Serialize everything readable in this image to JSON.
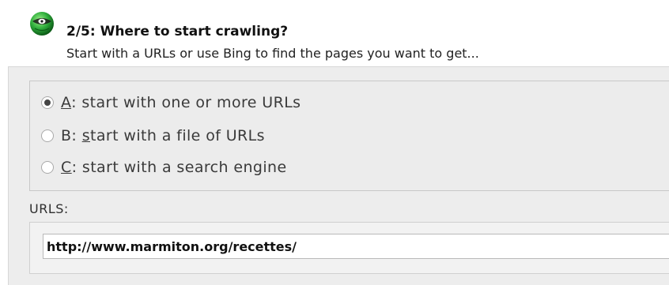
{
  "header": {
    "icon": "globe-icon",
    "title": "2/5: Where to start crawling?",
    "subtitle": "Start with a URLs or use Bing to find the pages you want to get..."
  },
  "options": {
    "selected": "A",
    "items": [
      {
        "mnemonic": "A",
        "rest": ": start with one or more URLs",
        "checked": true
      },
      {
        "prefix": "B: ",
        "mnemonic": "s",
        "rest": "tart with a file of URLs",
        "checked": false
      },
      {
        "mnemonic": "C",
        "rest": ": start with a search engine",
        "checked": false
      }
    ]
  },
  "urls": {
    "label": "URLS:",
    "value": "http://www.marmiton.org/recettes/"
  },
  "colors": {
    "globe_green": "#2fae3c",
    "panel_bg": "#ededed"
  }
}
